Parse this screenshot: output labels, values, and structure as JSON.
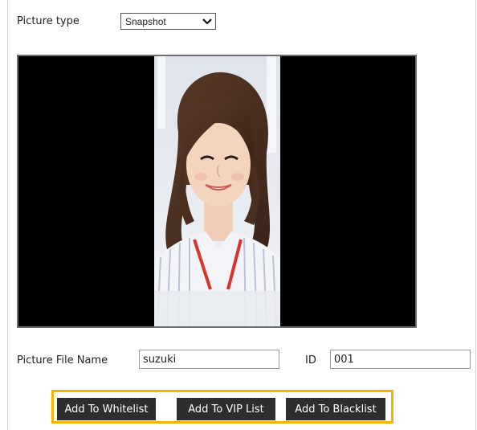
{
  "picture_type": {
    "label": "Picture type",
    "selected": "Snapshot",
    "chevron_icon": "chevron-down-icon"
  },
  "viewer": {
    "image_subject": "face-photo"
  },
  "file": {
    "name_label": "Picture File Name",
    "name_value": "suzuki",
    "id_label": "ID",
    "id_value": "001"
  },
  "actions": {
    "whitelist_label": "Add To Whitelist",
    "vip_label": "Add To VIP List",
    "blacklist_label": "Add To Blacklist",
    "highlight_color": "#f4b300",
    "button_color": "#2d2d2d"
  }
}
